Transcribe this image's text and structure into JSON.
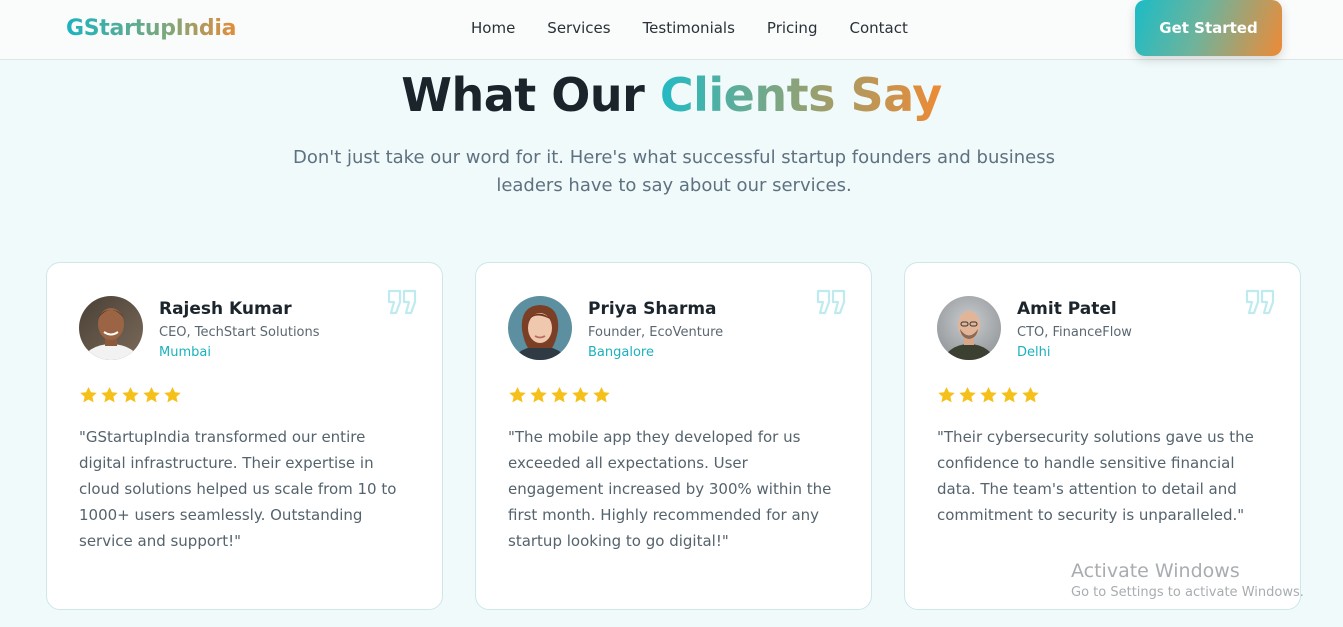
{
  "brand": {
    "logo": "GStartupIndia"
  },
  "nav": {
    "links": [
      "Home",
      "Services",
      "Testimonials",
      "Pricing",
      "Contact"
    ],
    "cta_label": "Get Started"
  },
  "section": {
    "heading_plain": "What Our ",
    "heading_accent": "Clients Say",
    "subtitle": "Don't just take our word for it. Here's what successful startup founders and business leaders have to say about our services."
  },
  "testimonials": [
    {
      "name": "Rajesh Kumar",
      "role": "CEO, TechStart Solutions",
      "city": "Mumbai",
      "rating": 5,
      "quote": "\"GStartupIndia transformed our entire digital infrastructure. Their expertise in cloud solutions helped us scale from 10 to 1000+ users seamlessly. Outstanding service and support!\""
    },
    {
      "name": "Priya Sharma",
      "role": "Founder, EcoVenture",
      "city": "Bangalore",
      "rating": 5,
      "quote": "\"The mobile app they developed for us exceeded all expectations. User engagement increased by 300% within the first month. Highly recommended for any startup looking to go digital!\""
    },
    {
      "name": "Amit Patel",
      "role": "CTO, FinanceFlow",
      "city": "Delhi",
      "rating": 5,
      "quote": "\"Their cybersecurity solutions gave us the confidence to handle sensitive financial data. The team's attention to detail and commitment to security is unparalleled.\""
    }
  ],
  "watermark": {
    "title": "Activate Windows",
    "subtitle": "Go to Settings to activate Windows."
  },
  "colors": {
    "accent_teal": "#1cb1be",
    "accent_orange": "#ee8a34",
    "star": "#f6c01a",
    "quote_icon": "#bfeaf0"
  }
}
